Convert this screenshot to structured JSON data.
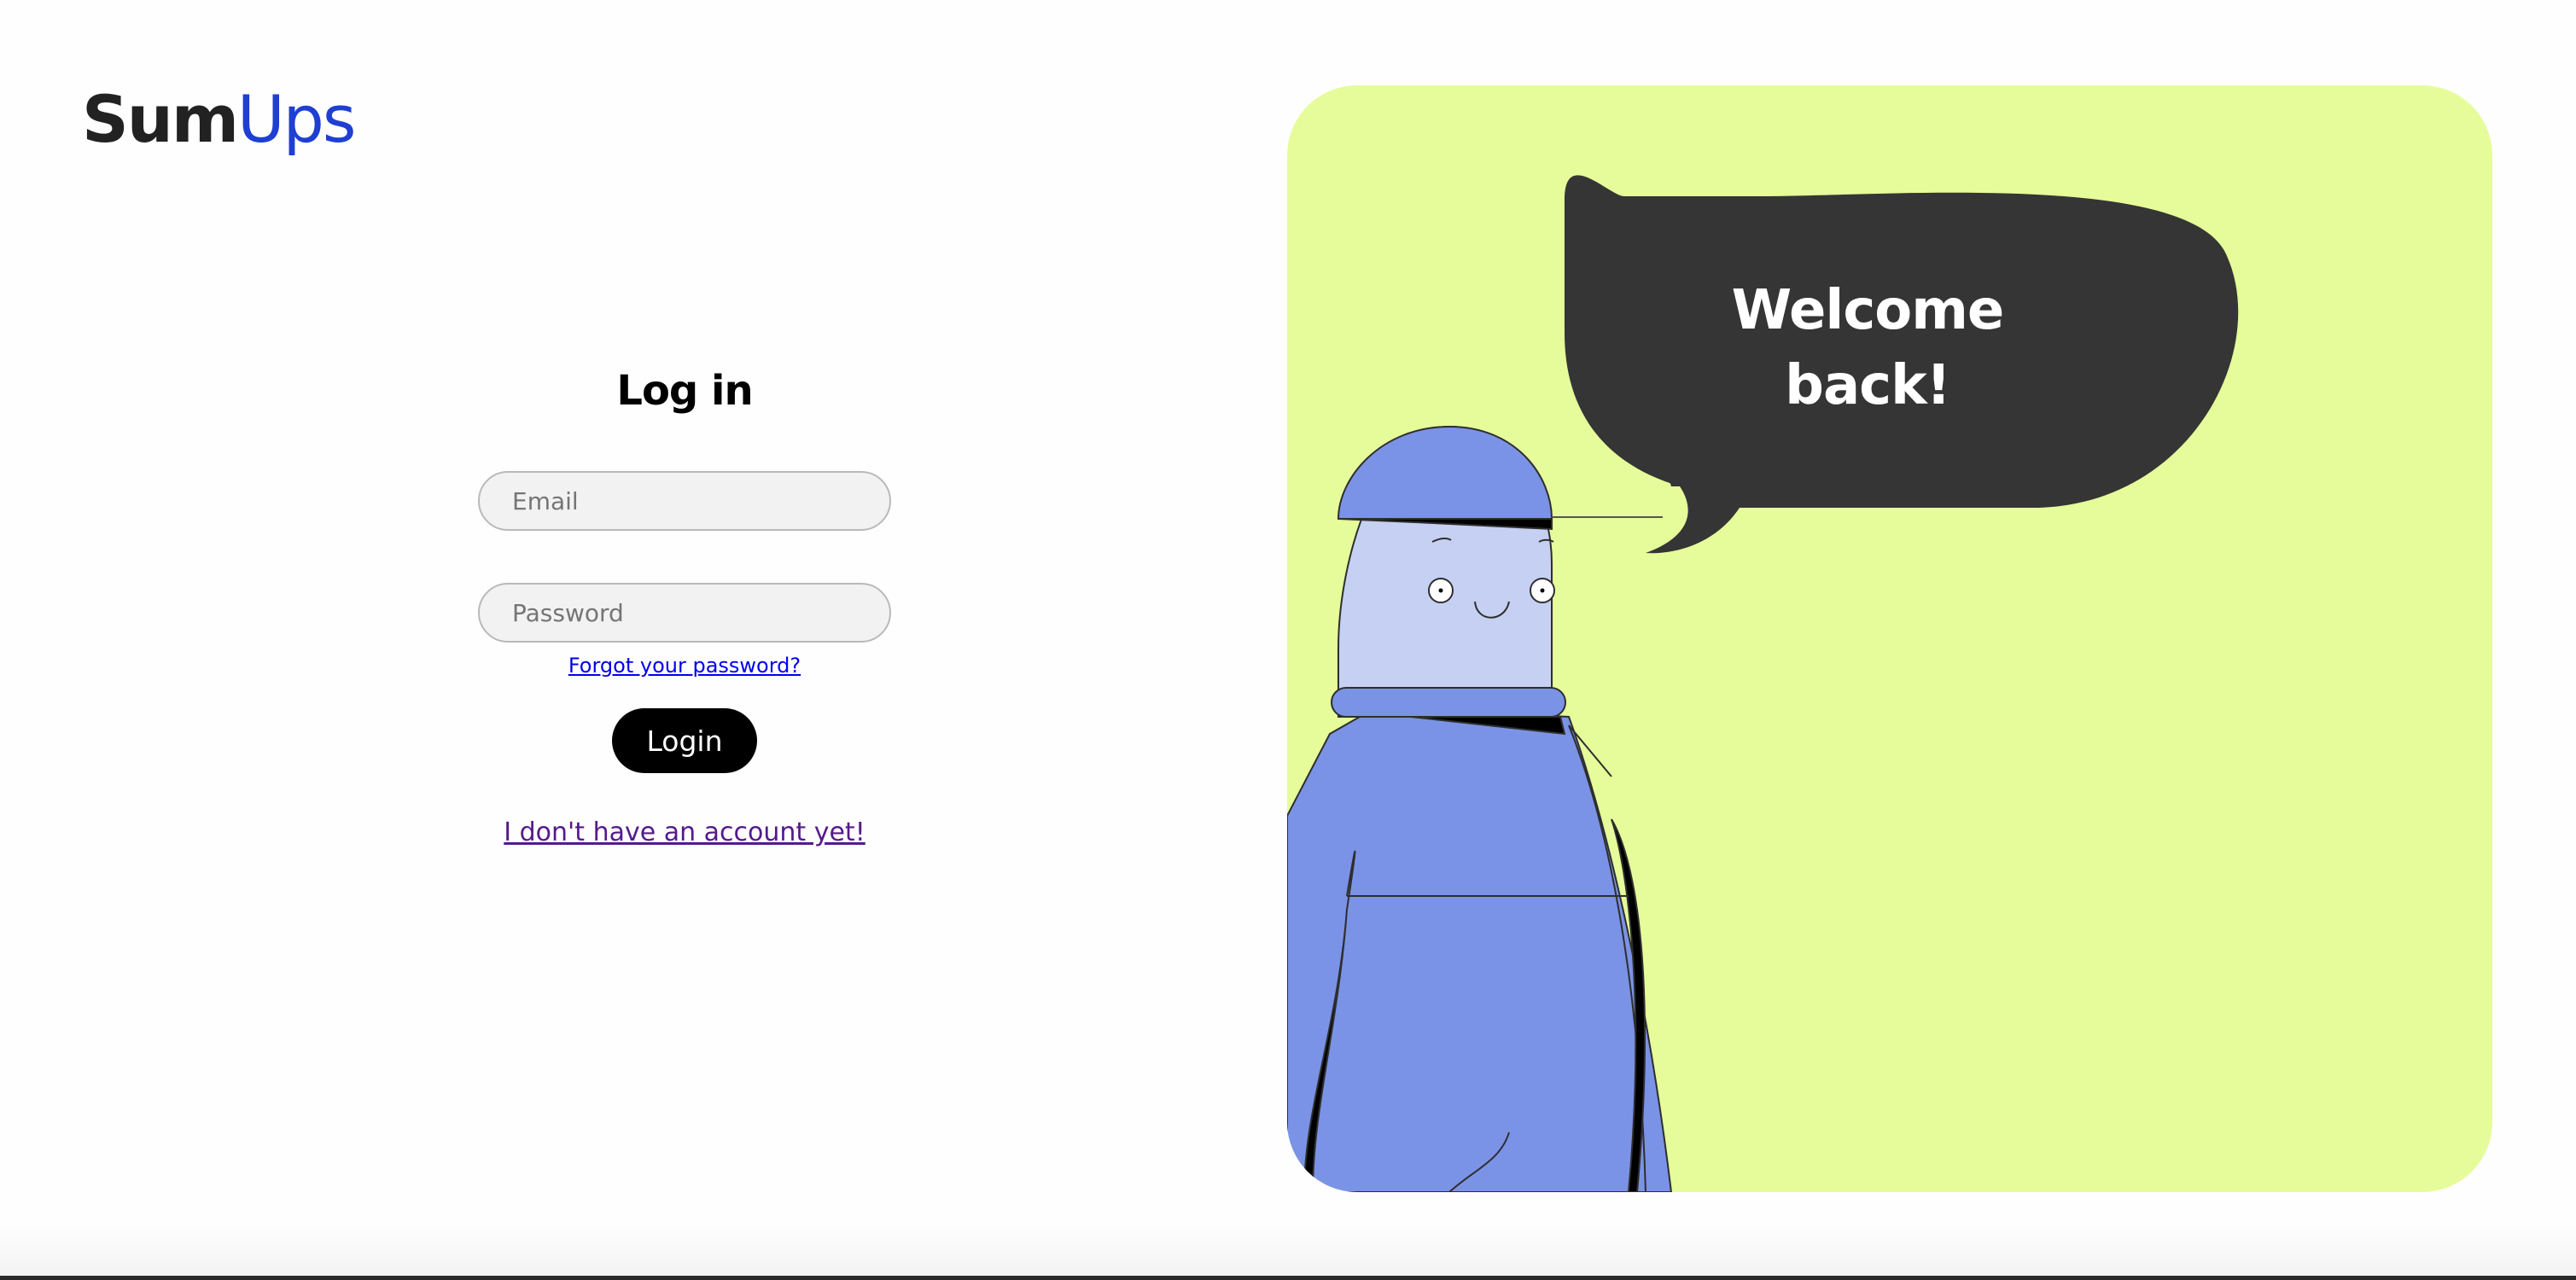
{
  "brand": {
    "logo_part1": "Sum",
    "logo_part2": "Ups",
    "accent_color": "#1f3fd1"
  },
  "login_form": {
    "title": "Log in",
    "email_placeholder": "Email",
    "password_placeholder": "Password",
    "forgot_password_label": "Forgot your password?",
    "login_button_label": "Login",
    "signup_link_label": "I don't have an account yet!"
  },
  "illustration": {
    "bubble_line1": "Welcome",
    "bubble_line2": "back!",
    "panel_color": "#e6fc9a",
    "bubble_color": "#353535",
    "character_color": "#7b93e6"
  }
}
